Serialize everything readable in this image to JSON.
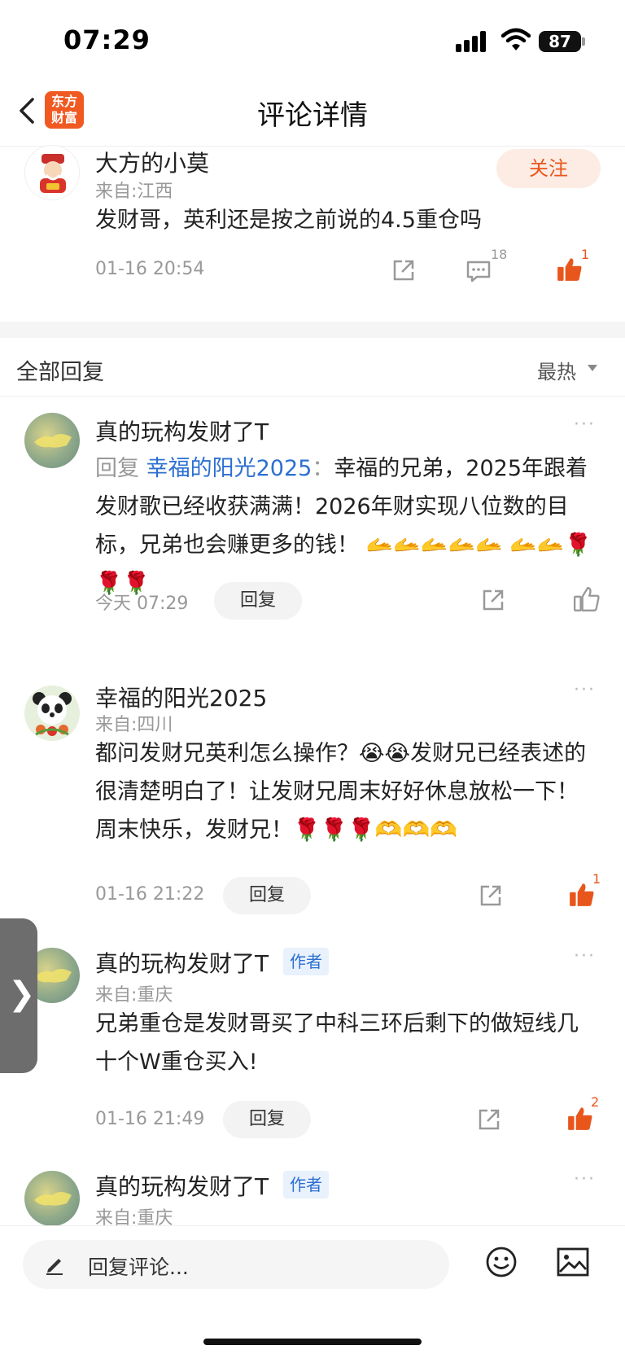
{
  "status": {
    "time": "07:29",
    "battery": "87"
  },
  "nav": {
    "title": "评论详情",
    "logo_text_line1": "东方",
    "logo_text_line2": "财富"
  },
  "main_comment": {
    "username": "大方的小莫",
    "from": "来自:江西",
    "follow_label": "关注",
    "text": "发财哥，英利还是按之前说的4.5重仓吗",
    "time": "01-16 20:54",
    "comment_count": "18",
    "like_count": "1"
  },
  "replies_header": {
    "title": "全部回复",
    "sort_label": "最热"
  },
  "replies": [
    {
      "username": "真的玩构发财了T",
      "reply_prefix": "回复",
      "mention": "幸福的阳光2025",
      "colon": "：",
      "text_line1": "幸福的兄弟，2025年",
      "text_rest": "跟着发财歌已经收获满满！2026年财实现八位数的目标，兄弟也会赚更多的钱！",
      "emojis_line": "🫴🫴🫴🫴🫴",
      "emojis_line2": "🫴🫴🌹🌹🌹",
      "time": "今天 07:29",
      "reply_label": "回复",
      "more": "···"
    },
    {
      "username": "幸福的阳光2025",
      "from": "来自:四川",
      "text": "都问发财兄英利怎么操作？😭😭发财兄已经表述的很清楚明白了！让发财兄周末好好休息放松一下！周末快乐，发财兄！🌹🌹🌹🫶🫶🫶",
      "time": "01-16 21:22",
      "reply_label": "回复",
      "like_count": "1",
      "more": "···"
    },
    {
      "username": "真的玩构发财了T",
      "author_tag": "作者",
      "from": "来自:重庆",
      "text": "兄弟重仓是发财哥买了中科三环后剩下的做短线几十个W重仓买入!",
      "time": "01-16 21:49",
      "reply_label": "回复",
      "like_count": "2",
      "more": "···"
    },
    {
      "username": "真的玩构发财了T",
      "author_tag": "作者",
      "from": "来自:重庆",
      "more": "···"
    }
  ],
  "bottom_bar": {
    "placeholder": "回复评论..."
  },
  "colors": {
    "accent": "#e8561c",
    "link": "#2c6fd1",
    "muted": "#999999"
  }
}
